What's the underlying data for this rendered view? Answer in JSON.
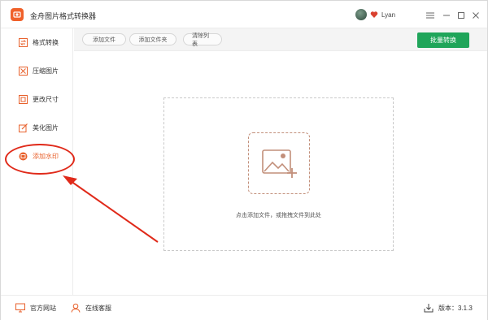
{
  "app": {
    "title": "金舟图片格式转换器",
    "user_name": "Lyan"
  },
  "window_controls": {
    "menu": "☰",
    "minimize": "−",
    "maximize": "□",
    "close": "✕"
  },
  "sidebar": {
    "items": [
      {
        "label": "格式转换",
        "icon": "convert-icon"
      },
      {
        "label": "压缩图片",
        "icon": "compress-icon"
      },
      {
        "label": "更改尺寸",
        "icon": "resize-icon"
      },
      {
        "label": "美化图片",
        "icon": "beautify-icon"
      },
      {
        "label": "添加水印",
        "icon": "watermark-icon",
        "active": true
      }
    ]
  },
  "toolbar": {
    "add_file": "添加文件",
    "add_folder": "添加文件夹",
    "clear_list": "清除列表",
    "batch_convert": "批量转换"
  },
  "dropzone": {
    "hint": "点击添加文件，或拖拽文件到此处"
  },
  "footer": {
    "website": "官方网站",
    "service": "在线客服",
    "version": "版本：3.1.3"
  },
  "colors": {
    "accent": "#e8612c",
    "primary_button": "#20a55a",
    "annotation": "#e02a1a"
  }
}
